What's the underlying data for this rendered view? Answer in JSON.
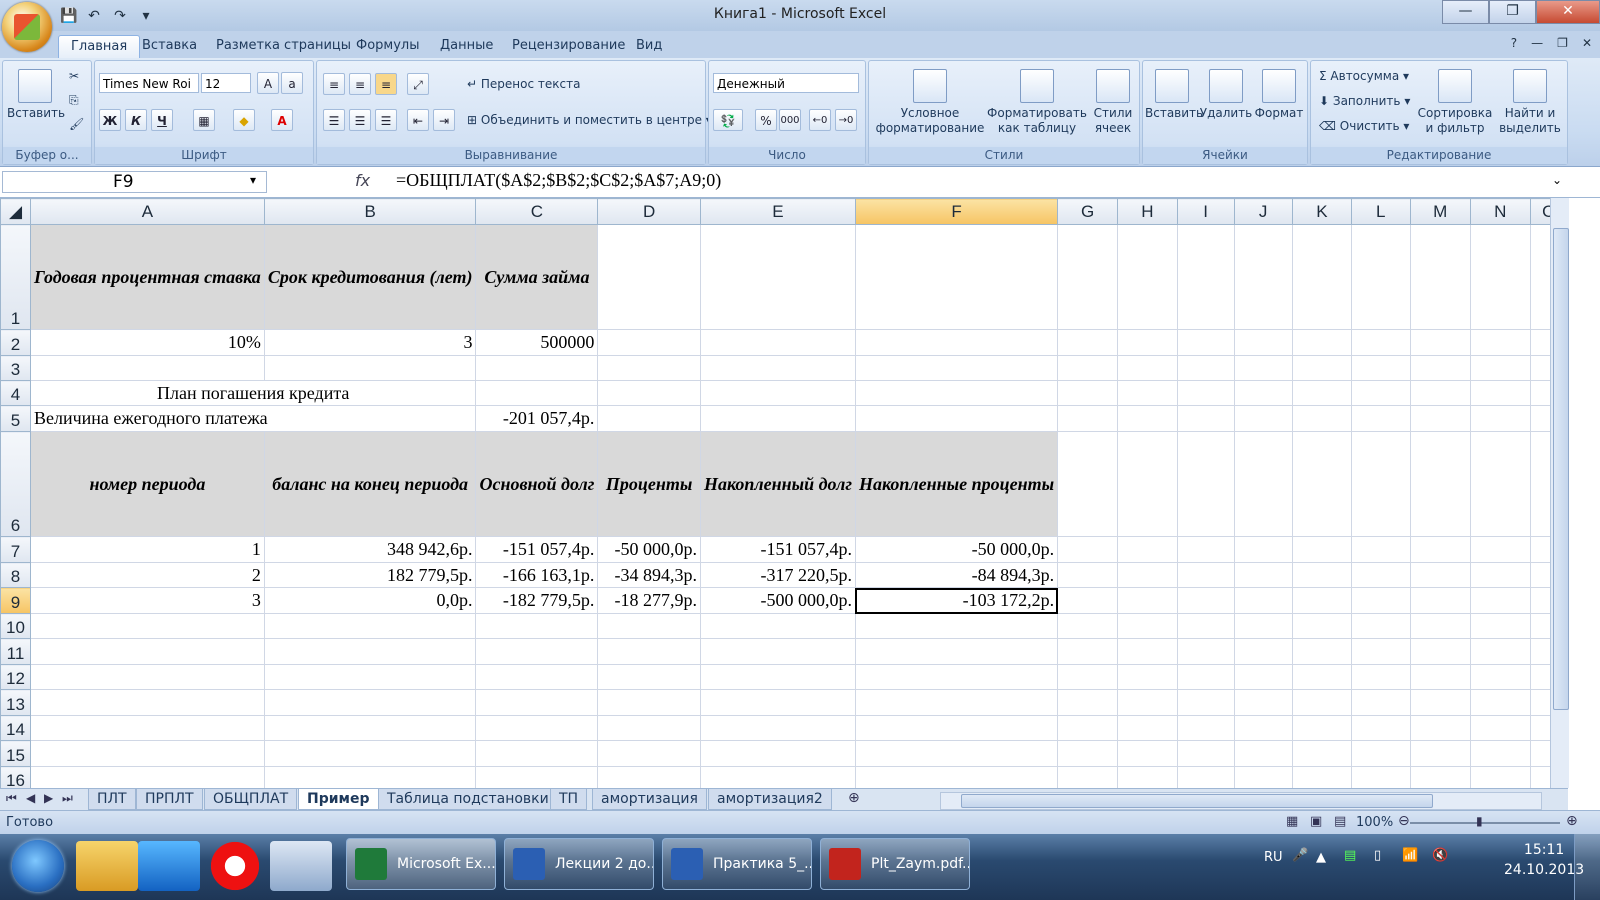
{
  "window": {
    "title": "Книга1 - Microsoft Excel",
    "minimize": "—",
    "maximize": "❐",
    "close": "✕"
  },
  "ribbon_tabs": [
    "Главная",
    "Вставка",
    "Разметка страницы",
    "Формулы",
    "Данные",
    "Рецензирование",
    "Вид"
  ],
  "ribbon": {
    "clipboard": {
      "paste": "Вставить",
      "label": "Буфер о..."
    },
    "font": {
      "name": "Times New Roi",
      "size": "12",
      "bold": "Ж",
      "italic": "К",
      "underline": "Ч",
      "label": "Шрифт"
    },
    "alignment": {
      "wrap": "Перенос текста",
      "merge": "Объединить и поместить в центре",
      "label": "Выравнивание"
    },
    "number": {
      "format": "Денежный",
      "percent": "%",
      "thousands": "000",
      "label": "Число"
    },
    "styles": {
      "conditional": "Условное форматирование",
      "format_table": "Форматировать как таблицу",
      "cell_styles": "Стили ячеек",
      "label": "Стили"
    },
    "cells": {
      "insert": "Вставить",
      "delete": "Удалить",
      "format": "Формат",
      "label": "Ячейки"
    },
    "editing": {
      "autosum": "Автосумма",
      "fill": "Заполнить",
      "clear": "Очистить",
      "sort": "Сортировка и фильтр",
      "find": "Найти и выделить",
      "label": "Редактирование"
    }
  },
  "formula_bar": {
    "name_box": "F9",
    "fx": "fx",
    "formula": "=ОБЩПЛАТ($A$2;$B$2;$C$2;$A$7;A9;0)"
  },
  "columns": [
    "A",
    "B",
    "C",
    "D",
    "E",
    "F",
    "G",
    "H",
    "I",
    "J",
    "K",
    "L",
    "M",
    "N",
    "O"
  ],
  "rows": [
    "1",
    "2",
    "3",
    "4",
    "5",
    "6",
    "7",
    "8",
    "9",
    "10",
    "11",
    "12",
    "13",
    "14",
    "15",
    "16"
  ],
  "cells": {
    "A1": "Годовая процентная ставка",
    "B1": "Срок кредитования (лет)",
    "C1": "Сумма займа",
    "A2": "10%",
    "B2": "3",
    "C2": "500000",
    "A4": "План погашения кредита",
    "A5": "Величина ежегодного платежа",
    "C5": "-201 057,4р.",
    "A6": "номер периода",
    "B6": "баланс на конец периода",
    "C6": "Основной долг",
    "D6": "Проценты",
    "E6": "Накопленный долг",
    "F6": "Накопленные проценты",
    "A7": "1",
    "B7": "348 942,6р.",
    "C7": "-151 057,4р.",
    "D7": "-50 000,0р.",
    "E7": "-151 057,4р.",
    "F7": "-50 000,0р.",
    "A8": "2",
    "B8": "182 779,5р.",
    "C8": "-166 163,1р.",
    "D8": "-34 894,3р.",
    "E8": "-317 220,5р.",
    "F8": "-84 894,3р.",
    "A9": "3",
    "B9": "0,0р.",
    "C9": "-182 779,5р.",
    "D9": "-18 277,9р.",
    "E9": "-500 000,0р.",
    "F9": "-103 172,2р."
  },
  "sheet_tabs": [
    "ПЛТ",
    "ПРПЛТ",
    "ОБЩПЛАТ",
    "Пример",
    "Таблица подстановки",
    "ТП",
    "амортизация",
    "амортизация2"
  ],
  "active_sheet": "Пример",
  "status": {
    "ready": "Готово",
    "zoom": "100%"
  },
  "taskbar": {
    "buttons": [
      "Microsoft Ex...",
      "Лекции 2 до...",
      "Практика 5_...",
      "Plt_Zaym.pdf..."
    ],
    "lang": "RU",
    "time": "15:11",
    "date": "24.10.2013"
  }
}
